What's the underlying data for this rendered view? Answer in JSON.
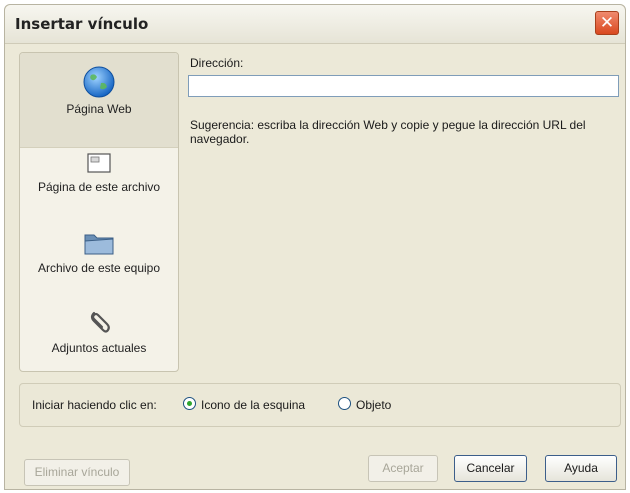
{
  "dialog": {
    "title": "Insertar vínculo"
  },
  "link_types": [
    {
      "label": "Página Web",
      "icon": "globe-icon"
    },
    {
      "label": "Página de este archivo",
      "icon": "page-icon"
    },
    {
      "label": "Archivo de este equipo",
      "icon": "folder-icon"
    },
    {
      "label": "Adjuntos actuales",
      "icon": "paperclip-icon"
    }
  ],
  "address": {
    "label": "Dirección:",
    "value": "",
    "hint": "Sugerencia: escriba la dirección Web y copie y pegue la dirección URL del navegador."
  },
  "start_option": {
    "label": "Iniciar haciendo clic en:",
    "options": [
      "Icono de la esquina",
      "Objeto"
    ],
    "selected": "Icono de la esquina"
  },
  "buttons": {
    "remove": "Eliminar vínculo",
    "accept": "Aceptar",
    "cancel": "Cancelar",
    "help": "Ayuda"
  },
  "colors": {
    "close_button": "#d9481f",
    "radio_checked": "#2fa52f",
    "accent_border": "#3c5e8a"
  }
}
